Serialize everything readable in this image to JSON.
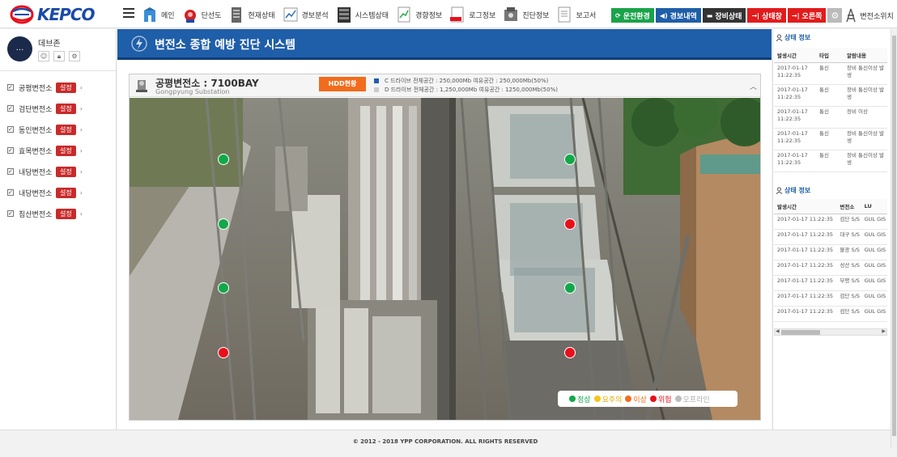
{
  "brand": {
    "logo_text": "KEPCO",
    "brand_color": "#1a4aa6",
    "accent_red": "#e8101a"
  },
  "topnav": [
    {
      "label": "메인",
      "icon": "main-icon"
    },
    {
      "label": "단선도",
      "icon": "single-line-diagram-icon"
    },
    {
      "label": "현재상태",
      "icon": "current-status-icon"
    },
    {
      "label": "경보분석",
      "icon": "alarm-analysis-icon"
    },
    {
      "label": "시스템상태",
      "icon": "system-status-icon"
    },
    {
      "label": "경향정보",
      "icon": "trend-icon"
    },
    {
      "label": "로그정보",
      "icon": "log-icon"
    },
    {
      "label": "진단정보",
      "icon": "diagnosis-icon"
    },
    {
      "label": "보고서",
      "icon": "report-icon"
    }
  ],
  "actions": {
    "operating_env": "운전환경",
    "alarm_history": "경보내역",
    "device_status": "장비상태",
    "status_window": "상태창",
    "alarm_window": "오른쪽",
    "substation_switch": "변전소위치"
  },
  "profile": {
    "name": "데브존",
    "avatar_text": "..."
  },
  "substations": [
    {
      "name": "공평변전소",
      "badge": "설정"
    },
    {
      "name": "검단변전소",
      "badge": "설정"
    },
    {
      "name": "동인변전소",
      "badge": "설정"
    },
    {
      "name": "효목변전소",
      "badge": "설정"
    },
    {
      "name": "내당변전소",
      "badge": "설정"
    },
    {
      "name": "내당변전소",
      "badge": "설정"
    },
    {
      "name": "침산변전소",
      "badge": "설정"
    }
  ],
  "main": {
    "banner_title": "변전소 종합 예방 진단 시스템",
    "station_title": "공평변전소 : 7100BAY",
    "station_subtitle": "Gongpyung Substation",
    "hdd_button": "HDD현황",
    "drive_c": "C 드라이브 전체공간 : 250,000Mb 여유공간 : 250,000Mb(50%)",
    "drive_d": "D 드라이브 전체공간 : 1,250,000Mb 여유공간 : 1250,000Mb(50%)",
    "drive_c_color": "#1f5ea8",
    "drive_d_color": "#cccccc"
  },
  "points": [
    {
      "status": "green"
    },
    {
      "status": "green"
    },
    {
      "status": "green"
    },
    {
      "status": "red"
    },
    {
      "status": "green"
    },
    {
      "status": "red"
    },
    {
      "status": "green"
    },
    {
      "status": "red"
    }
  ],
  "legend": [
    {
      "label": "정상",
      "color": "#12a84a",
      "text_color": "#12a84a"
    },
    {
      "label": "요주의",
      "color": "#f5c518",
      "text_color": "#e0a800"
    },
    {
      "label": "이상",
      "color": "#f26c1d",
      "text_color": "#f26c1d"
    },
    {
      "label": "위험",
      "color": "#e8101a",
      "text_color": "#e8101a"
    },
    {
      "label": "오프라인",
      "color": "#bdbdbd",
      "text_color": "#aaaaaa"
    }
  ],
  "status_panel": {
    "title": "상태 정보",
    "headers": [
      "발생시간",
      "타입",
      "알람내용"
    ],
    "rows": [
      [
        "2017-01-17 11:22:35",
        "통신",
        "장비 통신이상 발생"
      ],
      [
        "2017-01-17 11:22:35",
        "통신",
        "장비 통신이상 발생"
      ],
      [
        "2017-01-17 11:22:35",
        "통신",
        "장비 이상"
      ],
      [
        "2017-01-17 11:22:35",
        "통신",
        "장비 통신이상 발생"
      ],
      [
        "2017-01-17 11:22:35",
        "통신",
        "장비 통신이상 발생"
      ]
    ]
  },
  "status_panel2": {
    "title": "상태 정보",
    "headers": [
      "발생시간",
      "변전소",
      "LU"
    ],
    "rows": [
      [
        "2017-01-17 11:22:35",
        "검단 S/S",
        "GUL GIS"
      ],
      [
        "2017-01-17 11:22:35",
        "대구 S/S",
        "GUL GIS"
      ],
      [
        "2017-01-17 11:22:35",
        "불광 S/S",
        "GUL GIS"
      ],
      [
        "2017-01-17 11:22:35",
        "성산 S/S",
        "GUL GIS"
      ],
      [
        "2017-01-17 11:22:35",
        "부평 S/S",
        "GUL GIS"
      ],
      [
        "2017-01-17 11:22:35",
        "검단 S/S",
        "GUL GIS"
      ],
      [
        "2017-01-17 11:22:35",
        "검단 S/S",
        "GUL GIS"
      ]
    ]
  },
  "footer": {
    "text": "© 2012 - 2018 YPP CORPORATION. ALL RIGHTS RESERVED"
  }
}
